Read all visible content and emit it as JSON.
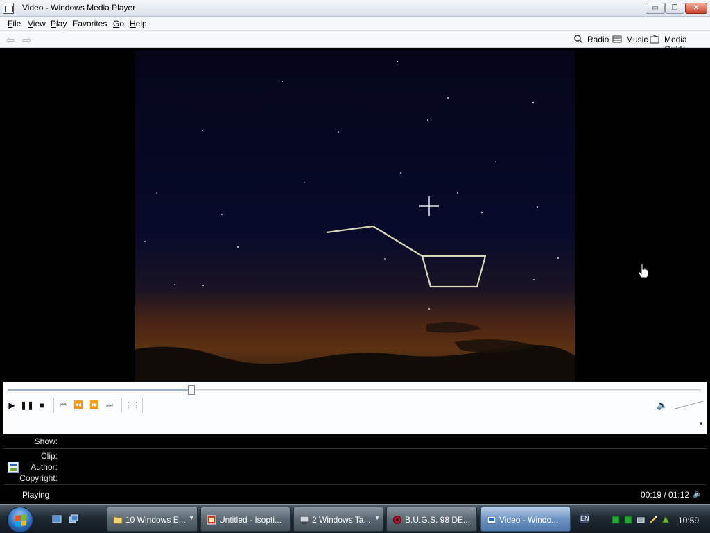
{
  "window": {
    "title": "Video - Windows Media Player",
    "buttons": {
      "minimize": "▭",
      "maximize": "❐",
      "close": "✕"
    }
  },
  "menu": [
    {
      "mn": "F",
      "rest": "ile"
    },
    {
      "mn": "V",
      "rest": "iew"
    },
    {
      "mn": "P",
      "rest": "lay"
    },
    {
      "mn": "",
      "rest": "Favorites"
    },
    {
      "mn": "G",
      "rest": "o"
    },
    {
      "mn": "H",
      "rest": "elp"
    }
  ],
  "nav": {
    "back": "⇦",
    "forward": "⇨",
    "radio": "Radio",
    "music": "Music",
    "media_guide": "Media Guide"
  },
  "playback": {
    "progress": 0.265,
    "play": "▶",
    "pause": "❚❚",
    "stop": "■",
    "prev": "⏮",
    "rewind": "⏪",
    "fast_forward": "⏩",
    "next": "⏭",
    "playlist": "⋮⋮",
    "volume_icon": "🔈",
    "caret": "▼"
  },
  "info": {
    "show_label": "Show:",
    "clip_label": "Clip:",
    "author_label": "Author:",
    "copyright_label": "Copyright:"
  },
  "status": {
    "state": "Playing",
    "time": "00:19 / 01:12",
    "speaker": "🔈"
  },
  "taskbar": {
    "tasks": [
      {
        "label": "10 Windows E...",
        "caret": "▼"
      },
      {
        "label": "Untitled - Isopti...",
        "caret": ""
      },
      {
        "label": "2 Windows Ta...",
        "caret": "▼"
      },
      {
        "label": "B.U.G.S. 98 DE...",
        "caret": ""
      },
      {
        "label": "Video - Windo...",
        "caret": ""
      }
    ],
    "lang": "EN",
    "clock": "10:59"
  }
}
